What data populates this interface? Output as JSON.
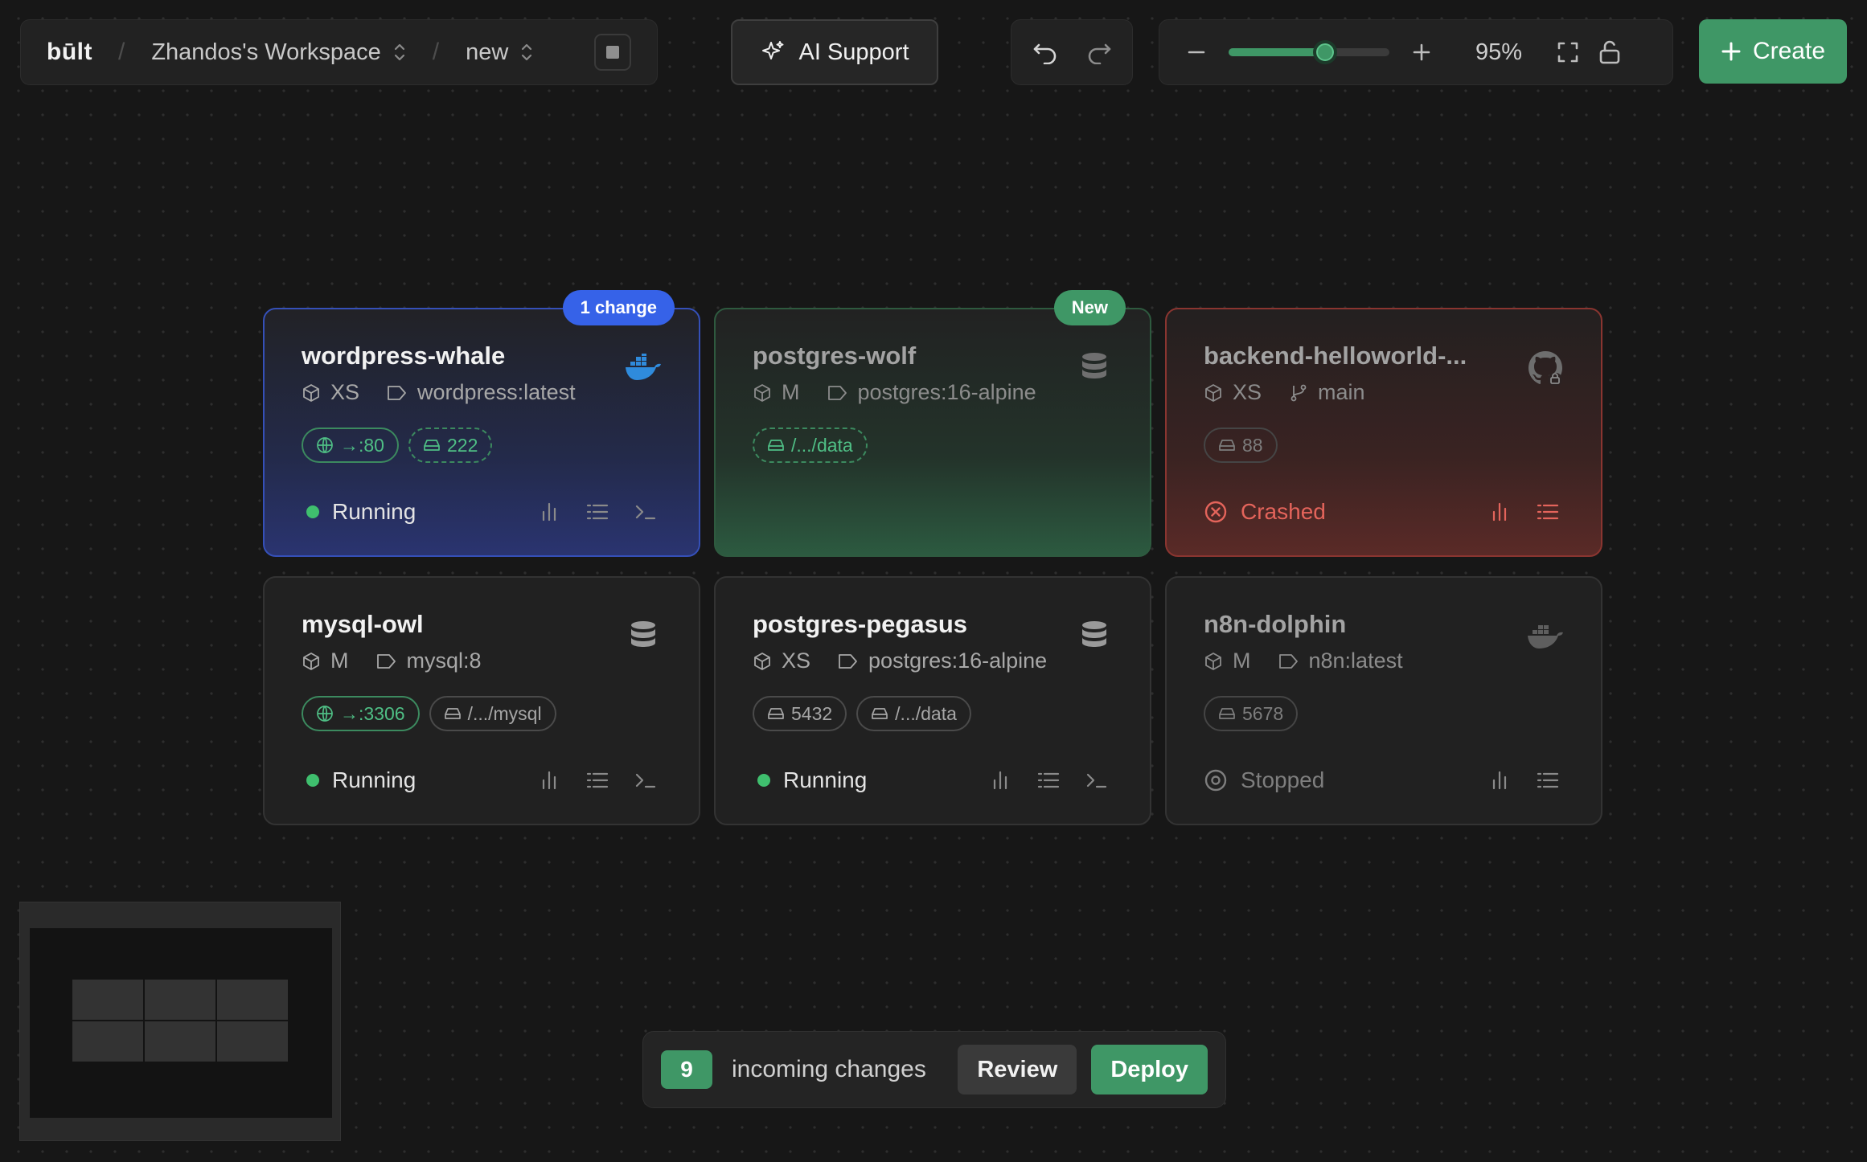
{
  "topbar": {
    "logo": "būlt",
    "workspace": "Zhandos's Workspace",
    "environment": "new",
    "ai_support_label": "AI Support",
    "zoom_level": "95%",
    "zoom_fraction": 0.6,
    "create_label": "Create"
  },
  "cards": [
    {
      "title": "wordpress-whale",
      "size": "XS",
      "source": "wordpress:latest",
      "badge": "1 change",
      "icon": "docker-icon",
      "chips": [
        "→:80",
        "222"
      ],
      "status": "Running"
    },
    {
      "title": "postgres-wolf",
      "size": "M",
      "source": "postgres:16-alpine",
      "badge": "New",
      "icon": "database-icon",
      "chips": [
        "/.../data"
      ],
      "status": ""
    },
    {
      "title": "backend-helloworld-...",
      "size": "XS",
      "source": "main",
      "icon": "github-icon",
      "chips": [
        "88"
      ],
      "status": "Crashed"
    },
    {
      "title": "mysql-owl",
      "size": "M",
      "source": "mysql:8",
      "icon": "database-icon",
      "chips": [
        "→:3306",
        "/.../mysql"
      ],
      "status": "Running"
    },
    {
      "title": "postgres-pegasus",
      "size": "XS",
      "source": "postgres:16-alpine",
      "icon": "database-icon",
      "chips": [
        "5432",
        "/.../data"
      ],
      "status": "Running"
    },
    {
      "title": "n8n-dolphin",
      "size": "M",
      "source": "n8n:latest",
      "icon": "docker-icon",
      "chips": [
        "5678"
      ],
      "status": "Stopped"
    }
  ],
  "changes_bar": {
    "count": "9",
    "text": "incoming changes",
    "review_label": "Review",
    "deploy_label": "Deploy"
  },
  "colors": {
    "accent": "#3f9766",
    "badge_blue": "#3662e8",
    "crashed": "#e4645b",
    "running": "#3fbf6e"
  }
}
